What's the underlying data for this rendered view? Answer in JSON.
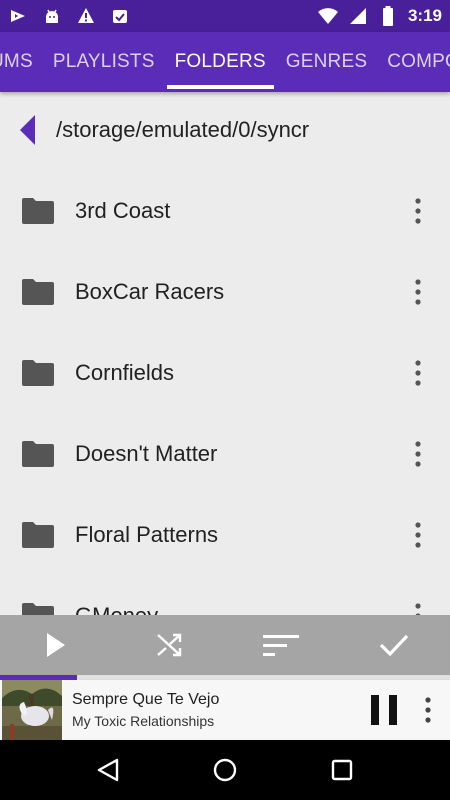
{
  "colors": {
    "accent": "#5b2cb8",
    "status_bar": "#4a1f9a",
    "action_bar": "#a5a5a5",
    "folder_icon": "#555555"
  },
  "status_bar": {
    "left_icons": [
      "play-store-icon",
      "android-icon",
      "warning-icon",
      "checklist-icon"
    ],
    "right_icons": [
      "wifi-icon",
      "signal-icon",
      "battery-icon"
    ],
    "time": "3:19"
  },
  "tabs": [
    {
      "label": "UMS",
      "active": false
    },
    {
      "label": "PLAYLISTS",
      "active": false
    },
    {
      "label": "FOLDERS",
      "active": true
    },
    {
      "label": "GENRES",
      "active": false
    },
    {
      "label": "COMPO",
      "active": false
    }
  ],
  "path": {
    "back_icon": "chevron-left-icon",
    "text": "/storage/emulated/0/syncr"
  },
  "folders": [
    {
      "name": "3rd Coast"
    },
    {
      "name": "BoxCar Racers"
    },
    {
      "name": "Cornfields"
    },
    {
      "name": "Doesn't Matter"
    },
    {
      "name": "Floral Patterns"
    },
    {
      "name": "GMoney"
    }
  ],
  "action_bar": {
    "icons": [
      "play-icon",
      "shuffle-icon",
      "sort-icon",
      "select-icon"
    ]
  },
  "now_playing": {
    "title": "Sempre Que Te Vejo",
    "artist": "My Toxic Relationships",
    "progress": 0.17,
    "pause_icon": "pause-icon",
    "more_icon": "more-vert-icon"
  },
  "nav_bar": {
    "icons": [
      "back-icon",
      "home-icon",
      "recents-icon"
    ]
  }
}
